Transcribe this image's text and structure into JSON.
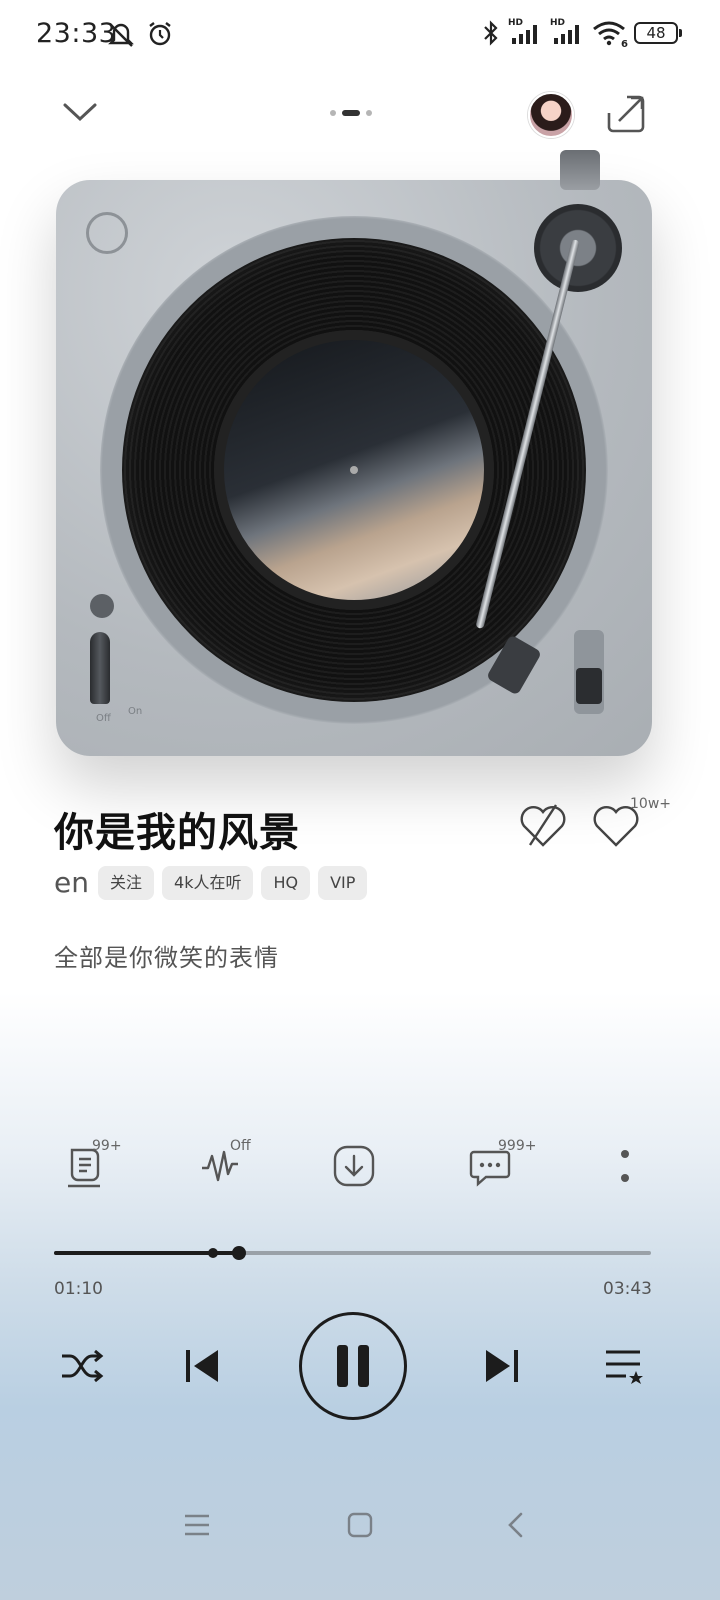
{
  "status_bar": {
    "time": "23:33",
    "battery": "48",
    "signal_1_label": "HD",
    "signal_2_label": "HD",
    "wifi_badge": "6"
  },
  "top_bar": {
    "collapse_icon": "chevron-down-icon",
    "page_indicator": {
      "count": 3,
      "active_index": 1
    },
    "share_icon": "share-icon"
  },
  "player_art": {
    "deck_on_label": "On",
    "deck_off_label": "Off"
  },
  "song": {
    "title": "你是我的风景",
    "artist": "en",
    "tags": [
      "关注",
      "4k人在听",
      "HQ",
      "VIP"
    ],
    "lyric": "全部是你微笑的表情",
    "like_count": "10w+"
  },
  "actions": {
    "lyrics_badge": "99+",
    "sound_effect_badge": "Off",
    "comments_badge": "999+"
  },
  "progress": {
    "current": "01:10",
    "total": "03:43",
    "fraction": 0.31
  },
  "colors": {
    "accent": "#1c1c1c",
    "track": "#9aa1a8",
    "tag_bg": "#ececec"
  }
}
